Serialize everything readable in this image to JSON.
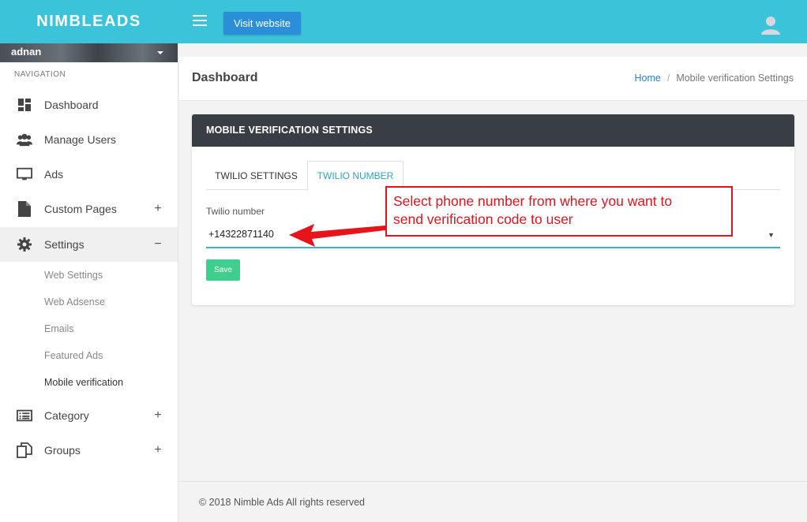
{
  "brand": "NIMBLEADS",
  "topbar": {
    "visit_label": "Visit website"
  },
  "sidebar": {
    "user_name": "adnan",
    "nav_title": "NAVIGATION",
    "items": [
      {
        "label": "Dashboard",
        "icon": "dashboard-icon"
      },
      {
        "label": "Manage Users",
        "icon": "users-icon"
      },
      {
        "label": "Ads",
        "icon": "monitor-icon"
      },
      {
        "label": "Custom Pages",
        "icon": "file-icon",
        "toggle": "+"
      },
      {
        "label": "Settings",
        "icon": "gear-icon",
        "toggle": "−"
      },
      {
        "label": "Category",
        "icon": "list-icon",
        "toggle": "+"
      },
      {
        "label": "Groups",
        "icon": "copy-icon",
        "toggle": "+"
      }
    ],
    "sub_items": [
      "Web Settings",
      "Web Adsense",
      "Emails",
      "Featured Ads",
      "Mobile verification"
    ]
  },
  "page": {
    "title": "Dashboard",
    "breadcrumb": {
      "home": "Home",
      "sep": "/",
      "current": "Mobile verification Settings"
    }
  },
  "card": {
    "title": "MOBILE VERIFICATION SETTINGS",
    "tabs": [
      "TWILIO SETTINGS",
      "TWILIO NUMBER"
    ],
    "field_label": "Twilio number",
    "selected_number": "+14322871140",
    "caret": "▼",
    "save_label": "Save"
  },
  "annotation": {
    "line1": "Select phone number from where you want to",
    "line2": "send verification code to user"
  },
  "footer": {
    "text": "© 2018 Nimble Ads All  rights reserved"
  },
  "colors": {
    "topbar": "#3bc4d9",
    "visit_button": "#2b8ed9",
    "card_header": "#393d44",
    "active_tab": "#2aa4c0",
    "save_button": "#3ecf8e",
    "annotation": "#e0141c"
  }
}
